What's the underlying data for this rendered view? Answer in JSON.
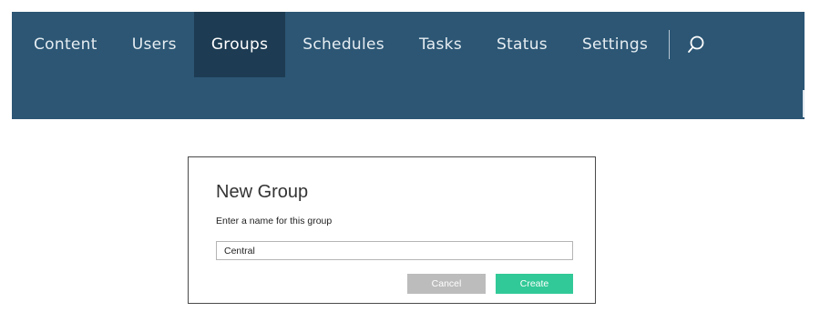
{
  "nav": {
    "items": [
      {
        "label": "Content"
      },
      {
        "label": "Users"
      },
      {
        "label": "Groups"
      },
      {
        "label": "Schedules"
      },
      {
        "label": "Tasks"
      },
      {
        "label": "Status"
      },
      {
        "label": "Settings"
      }
    ],
    "active_item": "Groups",
    "search_icon": "search-icon"
  },
  "dialog": {
    "title": "New Group",
    "subtitle": "Enter a name for this group",
    "name_value": "Central",
    "cancel_label": "Cancel",
    "create_label": "Create"
  },
  "colors": {
    "nav_background": "#2c5674",
    "nav_active": "#1d3c53",
    "create_button": "#31c997",
    "cancel_button": "#bcbcbc"
  }
}
